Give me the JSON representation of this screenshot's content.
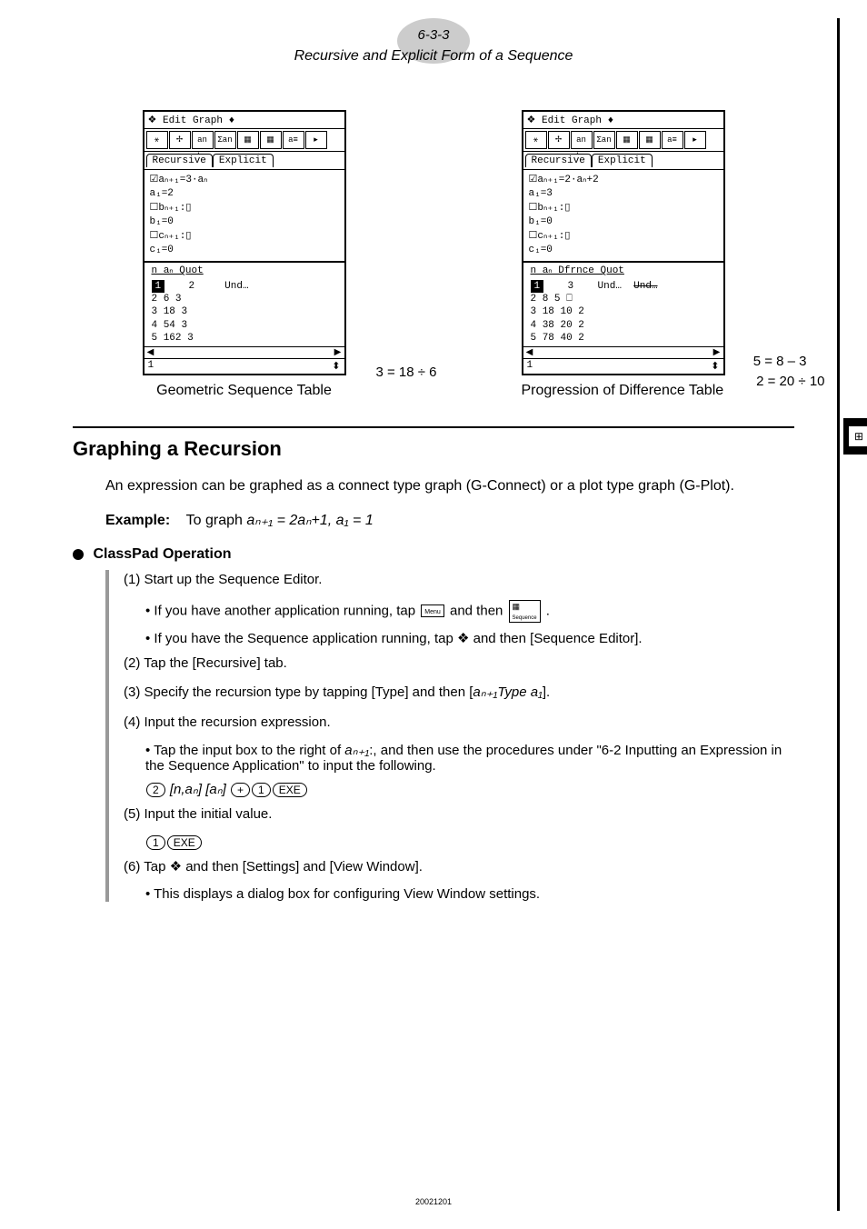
{
  "header": {
    "page_num": "6-3-3",
    "subtitle": "Recursive and Explicit Form of a Sequence"
  },
  "figures": {
    "left": {
      "menubar": "❖ Edit Graph ♦",
      "tab1": "Recursive",
      "tab2": "Explicit",
      "eq1": "☑aₙ₊₁=3·aₙ",
      "eq2": "  a₁=2",
      "eq3": "☐bₙ₊₁:▯",
      "eq4": "  b₁=0",
      "eq5": "☐cₙ₊₁:▯",
      "eq6": "  c₁=0",
      "table_header": "n    aₙ   Quot",
      "row1_n": "1",
      "row1_an": "2",
      "row1_q": "Und…",
      "row2": "2    6      3",
      "row3": "3   18      3",
      "row4": "4   54      3",
      "row5": "5  162      3",
      "status": "1",
      "annotation": "3 = 18 ÷ 6",
      "caption": "Geometric Sequence Table"
    },
    "right": {
      "menubar": "❖ Edit Graph ♦",
      "tab1": "Recursive",
      "tab2": "Explicit",
      "eq1": "☑aₙ₊₁=2·aₙ+2",
      "eq2": "  a₁=3",
      "eq3": "☐bₙ₊₁:▯",
      "eq4": "  b₁=0",
      "eq5": "☐cₙ₊₁:▯",
      "eq6": "  c₁=0",
      "table_header": "n    aₙ  Dfrnce Quot",
      "row1_n": "1",
      "row1_an": "3",
      "row1_d": "Und…",
      "row1_q": "Und…",
      "row2": "2    8    5    ⎕",
      "row3": "3   18   10    2",
      "row4": "4   38   20    2",
      "row5": "5   78   40    2",
      "status": "1",
      "annotation1": "5 = 8 – 3",
      "annotation2": "2 = 20 ÷ 10",
      "caption": "Progression of Difference Table"
    }
  },
  "section": {
    "title": "Graphing a Recursion",
    "intro": "An expression can be graphed as a connect type graph (G-Connect) or a plot type graph (G-Plot).",
    "example_label": "Example:",
    "example_text_pre": "To graph ",
    "example_formula": "aₙ₊₁ = 2aₙ+1, a₁ = 1",
    "operation_heading": "ClassPad Operation",
    "steps": {
      "s1": "(1) Start up the Sequence Editor.",
      "s1a": "• If you have another application running, tap ",
      "s1a_mid": " and then ",
      "s1a_end": ".",
      "s1b": "• If you have the Sequence application running, tap ❖ and then [Sequence Editor].",
      "s2": "(2) Tap the [Recursive] tab.",
      "s3_pre": "(3) Specify the recursion type by tapping [Type] and then [",
      "s3_formula": "aₙ₊₁Type a₁",
      "s3_post": "].",
      "s4": "(4) Input the recursion expression.",
      "s4a_pre": "• Tap the input box to the right of ",
      "s4a_mid": ":, and then use the procedures under \"6-2 Inputting an Expression in the Sequence Application\" to input the following.",
      "s4a_formula": "aₙ₊₁",
      "s4b_k1": "2",
      "s4b_t1": " [n,aₙ] [aₙ]",
      "s4b_k2": "+",
      "s4b_k3": "1",
      "s4b_k4": "EXE",
      "s5": "(5) Input the initial value.",
      "s5a_k1": "1",
      "s5a_k2": "EXE",
      "s6": "(6) Tap ❖ and then [Settings] and [View Window].",
      "s6a": "• This displays a dialog box for configuring View Window settings."
    }
  },
  "footer": "20021201"
}
